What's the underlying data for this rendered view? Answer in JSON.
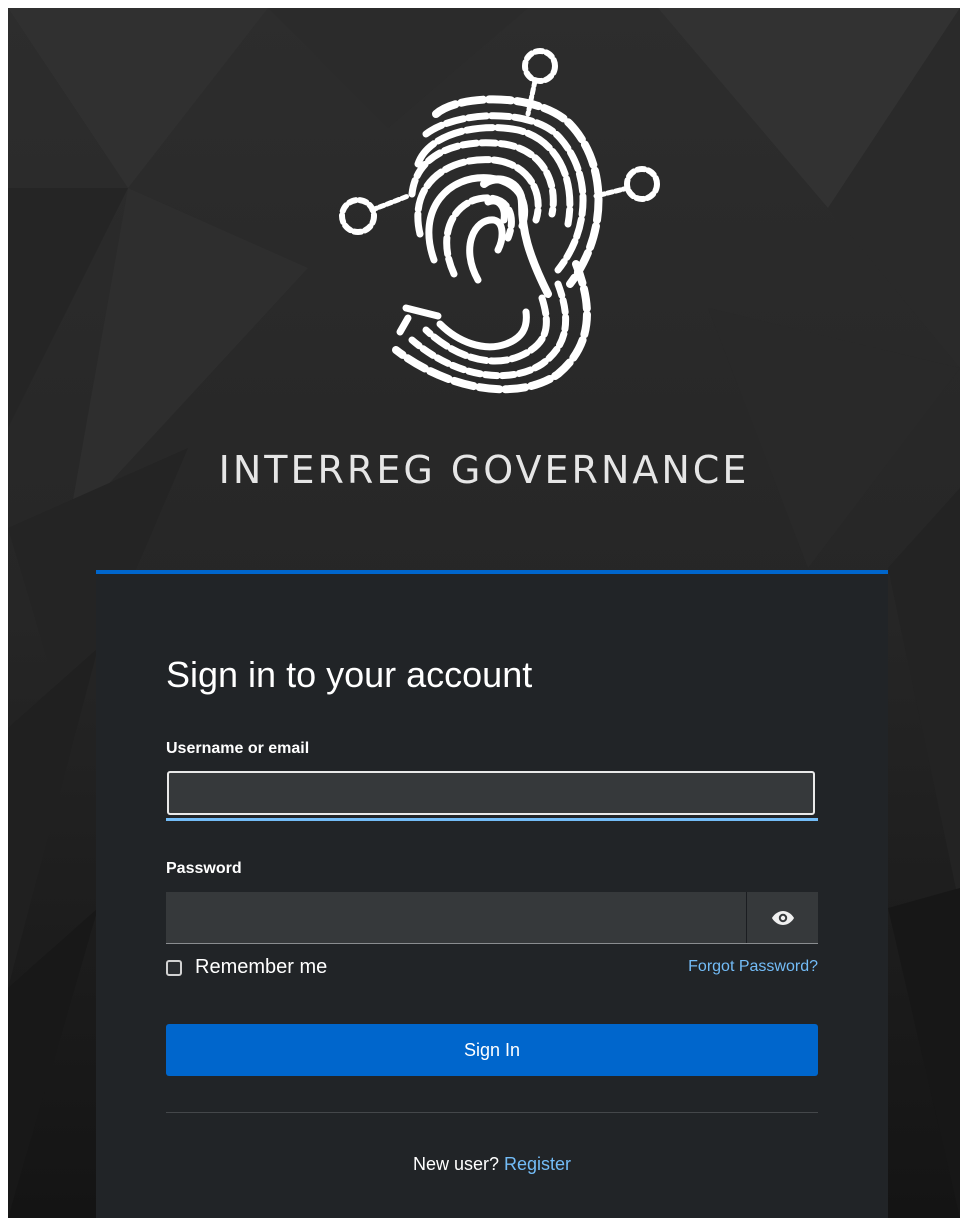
{
  "brand": {
    "logo_icon": "interreg-fingerprint-logo-icon",
    "name": "INTERREG GOVERNANCE"
  },
  "login": {
    "heading": "Sign in to your account",
    "username_label": "Username or email",
    "username_value": "",
    "password_label": "Password",
    "password_value": "",
    "show_password_icon": "eye-icon",
    "remember_label": "Remember me",
    "remember_checked": false,
    "forgot_label": "Forgot Password?",
    "submit_label": "Sign In",
    "new_user_text": "New user?",
    "register_label": "Register"
  },
  "colors": {
    "accent": "#0066cc",
    "link": "#73bcf7",
    "card_bg": "#212427",
    "page_bg": "#2a2a2a"
  }
}
